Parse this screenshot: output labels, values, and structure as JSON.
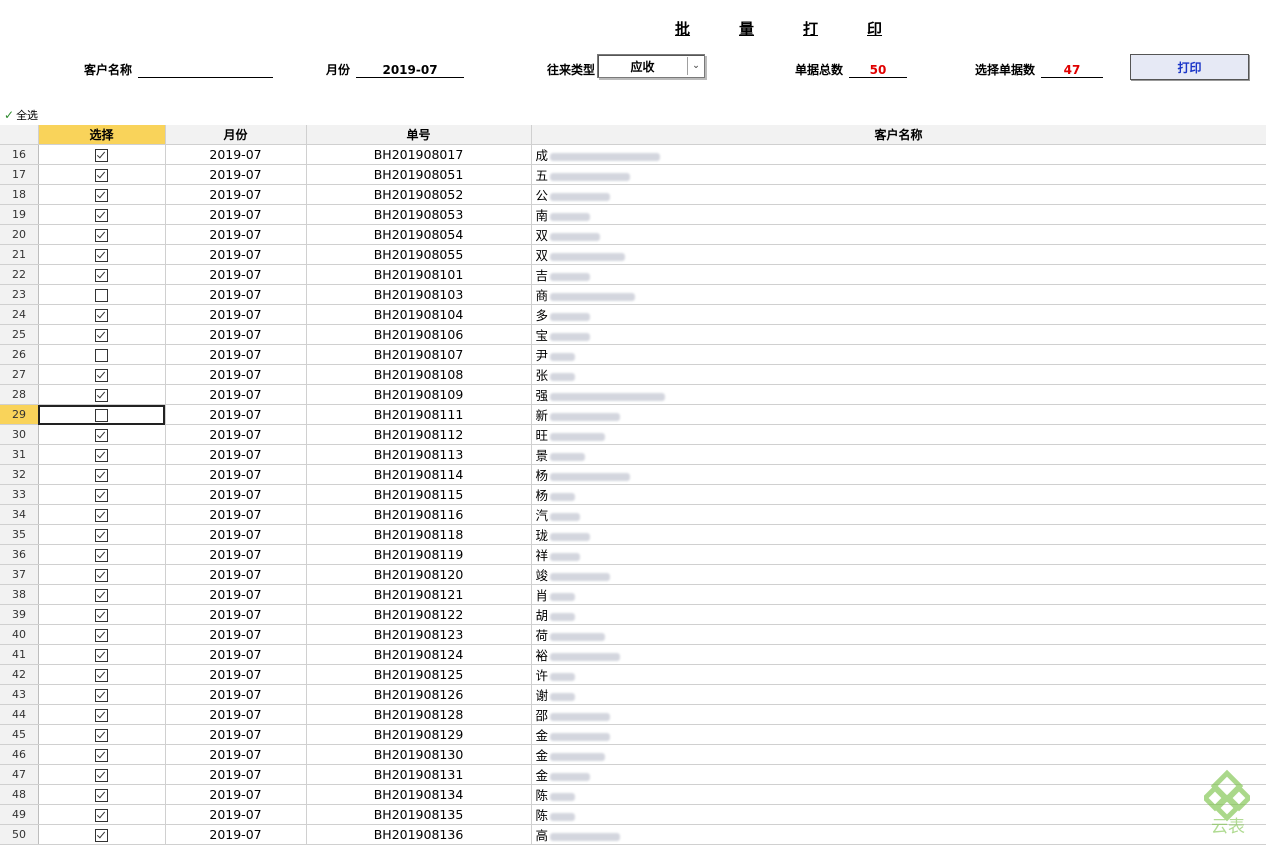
{
  "title_chars": [
    "批",
    "量",
    "打",
    "印"
  ],
  "header": {
    "customer_label": "客户名称",
    "customer_value": "",
    "month_label": "月份",
    "month_value": "2019-07",
    "type_label": "往来类型",
    "type_value": "应收",
    "total_label": "单据总数",
    "total_value": "50",
    "selected_label": "选择单据数",
    "selected_value": "47",
    "print_button": "打印"
  },
  "select_all_label": "全选",
  "select_all_icon": "check-icon",
  "columns": [
    "选择",
    "月份",
    "单号",
    "客户名称"
  ],
  "rows": [
    {
      "n": "16",
      "checked": true,
      "month": "2019-07",
      "no": "BH201908017",
      "cust": "成",
      "blurw": 110
    },
    {
      "n": "17",
      "checked": true,
      "month": "2019-07",
      "no": "BH201908051",
      "cust": "五",
      "blurw": 80
    },
    {
      "n": "18",
      "checked": true,
      "month": "2019-07",
      "no": "BH201908052",
      "cust": "公",
      "blurw": 60
    },
    {
      "n": "19",
      "checked": true,
      "month": "2019-07",
      "no": "BH201908053",
      "cust": "南",
      "blurw": 40
    },
    {
      "n": "20",
      "checked": true,
      "month": "2019-07",
      "no": "BH201908054",
      "cust": "双",
      "blurw": 50
    },
    {
      "n": "21",
      "checked": true,
      "month": "2019-07",
      "no": "BH201908055",
      "cust": "双",
      "blurw": 75
    },
    {
      "n": "22",
      "checked": true,
      "month": "2019-07",
      "no": "BH201908101",
      "cust": "吉",
      "blurw": 40
    },
    {
      "n": "23",
      "checked": false,
      "month": "2019-07",
      "no": "BH201908103",
      "cust": "商",
      "blurw": 85
    },
    {
      "n": "24",
      "checked": true,
      "month": "2019-07",
      "no": "BH201908104",
      "cust": "多",
      "blurw": 40
    },
    {
      "n": "25",
      "checked": true,
      "month": "2019-07",
      "no": "BH201908106",
      "cust": "宝",
      "blurw": 40
    },
    {
      "n": "26",
      "checked": false,
      "month": "2019-07",
      "no": "BH201908107",
      "cust": "尹",
      "blurw": 25
    },
    {
      "n": "27",
      "checked": true,
      "month": "2019-07",
      "no": "BH201908108",
      "cust": "张",
      "blurw": 25
    },
    {
      "n": "28",
      "checked": true,
      "month": "2019-07",
      "no": "BH201908109",
      "cust": "强",
      "blurw": 115
    },
    {
      "n": "29",
      "checked": false,
      "month": "2019-07",
      "no": "BH201908111",
      "cust": "新",
      "blurw": 70,
      "active": true
    },
    {
      "n": "30",
      "checked": true,
      "month": "2019-07",
      "no": "BH201908112",
      "cust": "旺",
      "blurw": 55
    },
    {
      "n": "31",
      "checked": true,
      "month": "2019-07",
      "no": "BH201908113",
      "cust": "景",
      "blurw": 35
    },
    {
      "n": "32",
      "checked": true,
      "month": "2019-07",
      "no": "BH201908114",
      "cust": "杨",
      "blurw": 80
    },
    {
      "n": "33",
      "checked": true,
      "month": "2019-07",
      "no": "BH201908115",
      "cust": "杨",
      "blurw": 25
    },
    {
      "n": "34",
      "checked": true,
      "month": "2019-07",
      "no": "BH201908116",
      "cust": "汽",
      "blurw": 30
    },
    {
      "n": "35",
      "checked": true,
      "month": "2019-07",
      "no": "BH201908118",
      "cust": "珑",
      "blurw": 40
    },
    {
      "n": "36",
      "checked": true,
      "month": "2019-07",
      "no": "BH201908119",
      "cust": "祥",
      "blurw": 30
    },
    {
      "n": "37",
      "checked": true,
      "month": "2019-07",
      "no": "BH201908120",
      "cust": "竣",
      "blurw": 60
    },
    {
      "n": "38",
      "checked": true,
      "month": "2019-07",
      "no": "BH201908121",
      "cust": "肖",
      "blurw": 25
    },
    {
      "n": "39",
      "checked": true,
      "month": "2019-07",
      "no": "BH201908122",
      "cust": "胡",
      "blurw": 25
    },
    {
      "n": "40",
      "checked": true,
      "month": "2019-07",
      "no": "BH201908123",
      "cust": "荷",
      "blurw": 55
    },
    {
      "n": "41",
      "checked": true,
      "month": "2019-07",
      "no": "BH201908124",
      "cust": "裕",
      "blurw": 70
    },
    {
      "n": "42",
      "checked": true,
      "month": "2019-07",
      "no": "BH201908125",
      "cust": "许",
      "blurw": 25
    },
    {
      "n": "43",
      "checked": true,
      "month": "2019-07",
      "no": "BH201908126",
      "cust": "谢",
      "blurw": 25
    },
    {
      "n": "44",
      "checked": true,
      "month": "2019-07",
      "no": "BH201908128",
      "cust": "邵",
      "blurw": 60
    },
    {
      "n": "45",
      "checked": true,
      "month": "2019-07",
      "no": "BH201908129",
      "cust": "金",
      "blurw": 60
    },
    {
      "n": "46",
      "checked": true,
      "month": "2019-07",
      "no": "BH201908130",
      "cust": "金",
      "blurw": 55
    },
    {
      "n": "47",
      "checked": true,
      "month": "2019-07",
      "no": "BH201908131",
      "cust": "金",
      "blurw": 40
    },
    {
      "n": "48",
      "checked": true,
      "month": "2019-07",
      "no": "BH201908134",
      "cust": "陈",
      "blurw": 25
    },
    {
      "n": "49",
      "checked": true,
      "month": "2019-07",
      "no": "BH201908135",
      "cust": "陈",
      "blurw": 25
    },
    {
      "n": "50",
      "checked": true,
      "month": "2019-07",
      "no": "BH201908136",
      "cust": "高",
      "blurw": 70
    }
  ],
  "watermark_text": "云表",
  "colors": {
    "accent_red": "#e00000",
    "print_text": "#1a35c8",
    "header_yellow": "#f9d35a",
    "logo_green": "#7cc44a"
  }
}
